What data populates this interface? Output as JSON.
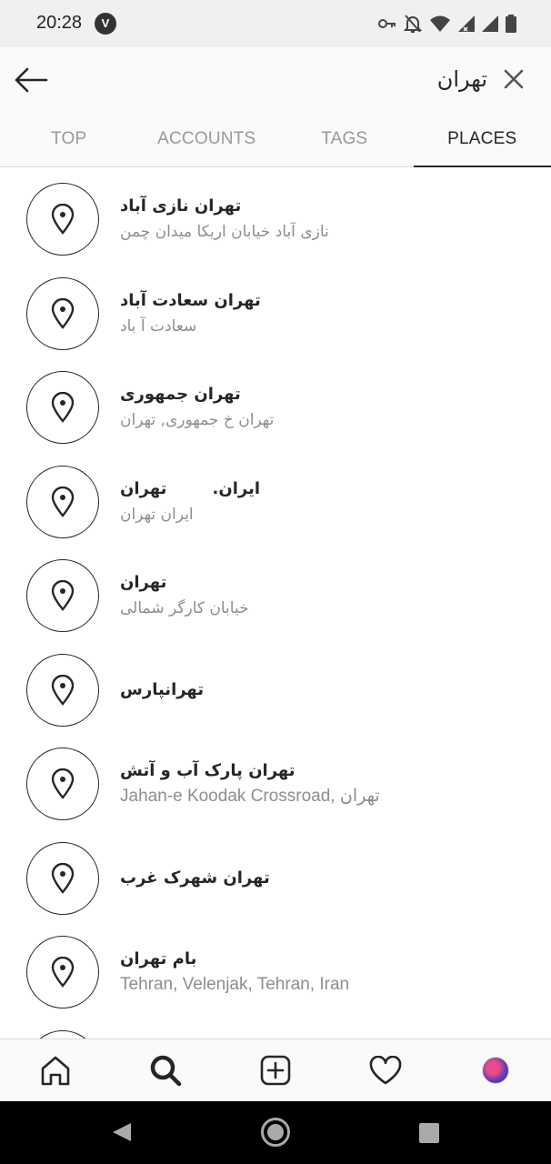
{
  "status_bar": {
    "time": "20:28",
    "vpn_badge": "V",
    "icons": [
      "key-icon",
      "bell-off-icon",
      "wifi-icon",
      "signal-icon",
      "signal-icon",
      "battery-icon"
    ]
  },
  "search": {
    "query": "تهران",
    "back_icon": "arrow-left-icon",
    "clear_icon": "close-icon"
  },
  "tabs": [
    {
      "label": "TOP",
      "active": false
    },
    {
      "label": "ACCOUNTS",
      "active": false
    },
    {
      "label": "TAGS",
      "active": false
    },
    {
      "label": "PLACES",
      "active": true
    }
  ],
  "places": [
    {
      "title": "تهران نازی آباد",
      "subtitle": "نازی آباد خیابان اریکا میدان چمن"
    },
    {
      "title": "تهران سعادت آباد",
      "subtitle": "سعادت آ باد"
    },
    {
      "title": "تهران جمهوری",
      "subtitle": "تهران خ جمهوری, تهران"
    },
    {
      "title": "ایران.        تهران",
      "subtitle": "ایران تهران"
    },
    {
      "title": "تهران",
      "subtitle": "خیابان کارگر شمالی"
    },
    {
      "title": "تهرانپارس",
      "subtitle": ""
    },
    {
      "title": "تهران پارک آب و آتش",
      "subtitle": "Jahan-e Koodak Crossroad, تهران"
    },
    {
      "title": "تهران شهرک غرب",
      "subtitle": ""
    },
    {
      "title": "بام تهران",
      "subtitle": "Tehran, Velenjak, Tehran, Iran"
    }
  ],
  "bottom_nav": [
    {
      "icon": "home-icon"
    },
    {
      "icon": "search-icon"
    },
    {
      "icon": "add-post-icon"
    },
    {
      "icon": "heart-icon"
    },
    {
      "icon": "profile-avatar"
    }
  ],
  "system_nav": [
    "back-icon",
    "home-icon",
    "recents-icon"
  ]
}
